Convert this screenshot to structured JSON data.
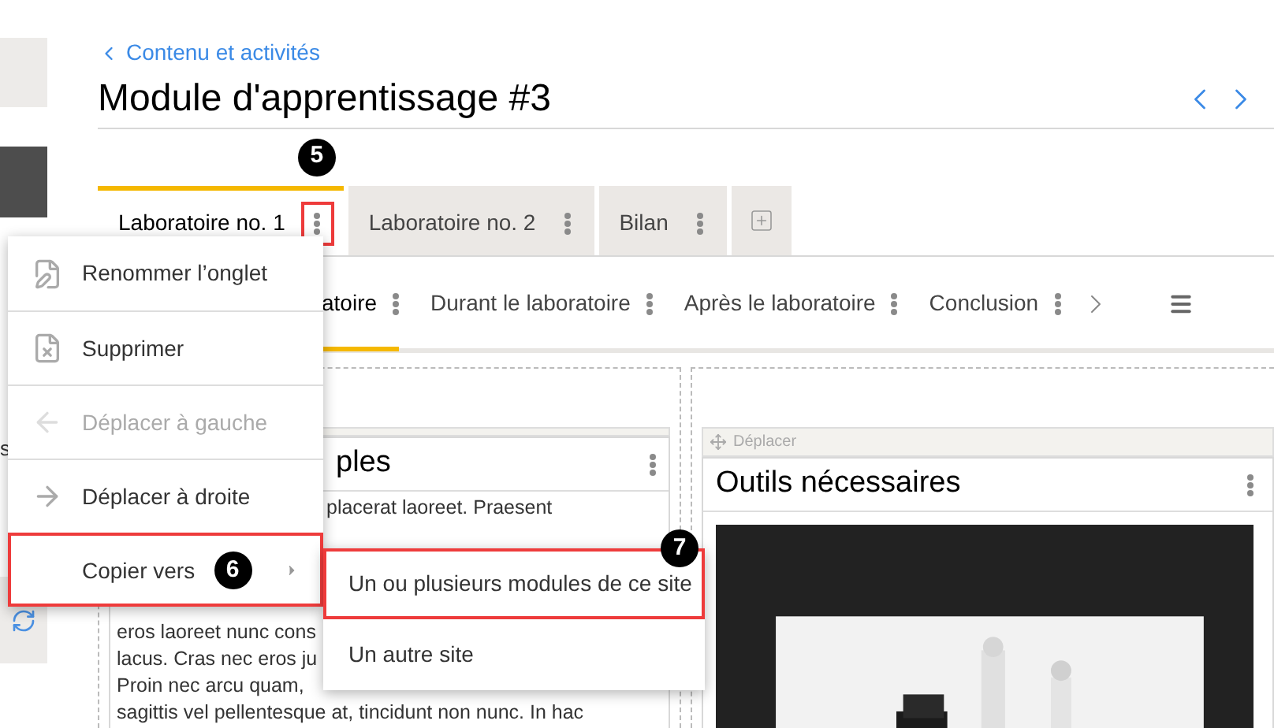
{
  "sidebar": {
    "fragment": "s"
  },
  "breadcrumb": {
    "label": "Contenu et activités"
  },
  "title": "Module d'apprentissage #3",
  "tab_callout": "5",
  "tabs": [
    {
      "label": "Laboratoire no. 1",
      "selected": true,
      "highlighted": true
    },
    {
      "label": "Laboratoire no. 2",
      "selected": false,
      "highlighted": false
    },
    {
      "label": "Bilan",
      "selected": false,
      "highlighted": false
    }
  ],
  "subtabs": [
    {
      "label": "atoire",
      "selected": true
    },
    {
      "label": "Durant le laboratoire",
      "selected": false
    },
    {
      "label": "Après le laboratoire",
      "selected": false
    },
    {
      "label": "Conclusion",
      "selected": false
    }
  ],
  "left_card": {
    "title": "ples",
    "lines": [
      "placerat laoreet. Praesent",
      "eros laoreet nunc cons",
      "lacus. Cras nec eros ju",
      "Proin nec arcu quam,",
      "sagittis vel pellentesque at, tincidunt non nunc. In hac"
    ]
  },
  "right_card": {
    "move_label": "Déplacer",
    "title": "Outils nécessaires"
  },
  "menu": {
    "items": [
      {
        "label": "Renommer l’onglet",
        "kind": "rename",
        "disabled": false,
        "highlighted": false
      },
      {
        "label": "Supprimer",
        "kind": "delete",
        "disabled": false,
        "highlighted": false
      },
      {
        "label": "Déplacer à gauche",
        "kind": "left",
        "disabled": true,
        "highlighted": false
      },
      {
        "label": "Déplacer à droite",
        "kind": "right",
        "disabled": false,
        "highlighted": false
      },
      {
        "label": "Copier vers",
        "kind": "submenu",
        "disabled": false,
        "highlighted": true,
        "callout": "6"
      }
    ]
  },
  "submenu": {
    "callout": "7",
    "items": [
      {
        "label": "Un ou plusieurs modules de ce site",
        "highlighted": true
      },
      {
        "label": "Un autre site",
        "highlighted": false
      }
    ]
  }
}
